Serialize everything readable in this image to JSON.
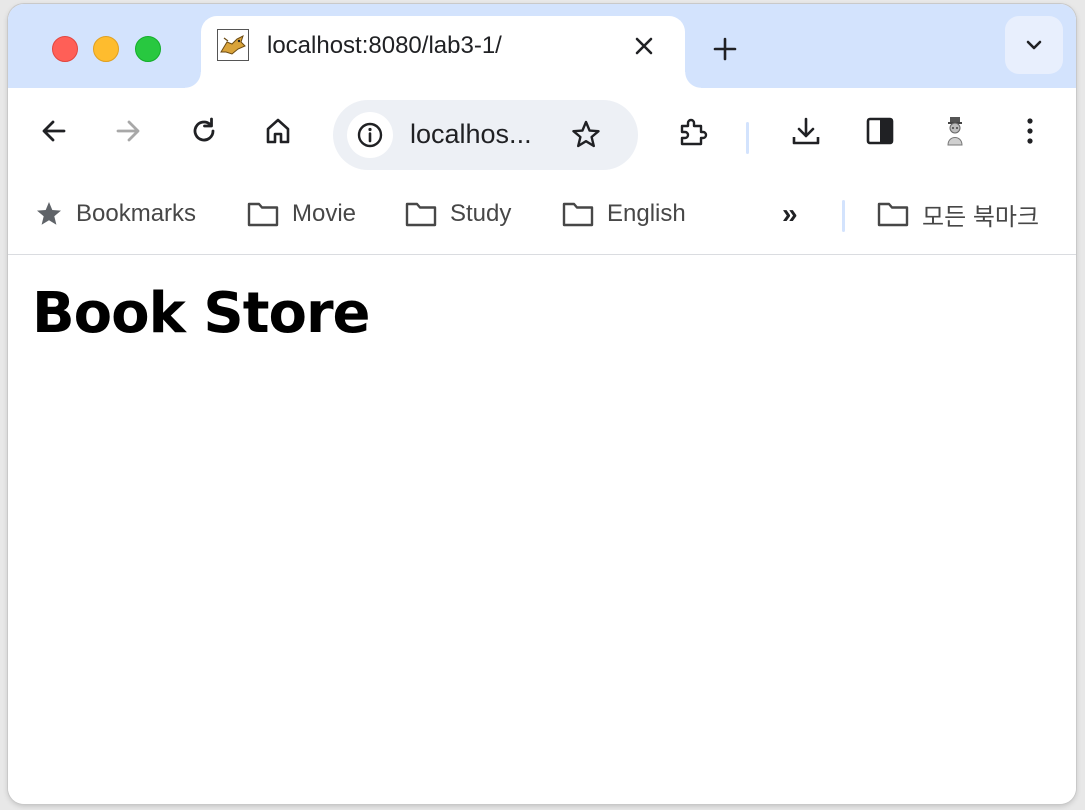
{
  "tab": {
    "favicon": "tomcat-favicon",
    "title": "localhost:8080/lab3-1/"
  },
  "toolbar": {
    "url": "localhos...",
    "icons": [
      "back-icon",
      "forward-icon",
      "reload-icon",
      "home-icon",
      "info-icon",
      "star-icon",
      "extensions-icon",
      "download-icon",
      "side-panel-icon",
      "profile-avatar",
      "more-menu-icon"
    ]
  },
  "bookmarks": {
    "items": [
      {
        "label": "Bookmarks",
        "icon": "star-icon"
      },
      {
        "label": "Movie",
        "icon": "folder-icon"
      },
      {
        "label": "Study",
        "icon": "folder-icon"
      },
      {
        "label": "English",
        "icon": "folder-icon"
      }
    ],
    "overflow": "»",
    "all_bookmarks": "모든 북마크"
  },
  "page": {
    "heading": "Book Store"
  },
  "colors": {
    "tabstrip": "#d3e3fd",
    "omnibox": "#edf0f5",
    "close": "#ff5f57",
    "minimize": "#febc2e",
    "zoom": "#28c840"
  }
}
